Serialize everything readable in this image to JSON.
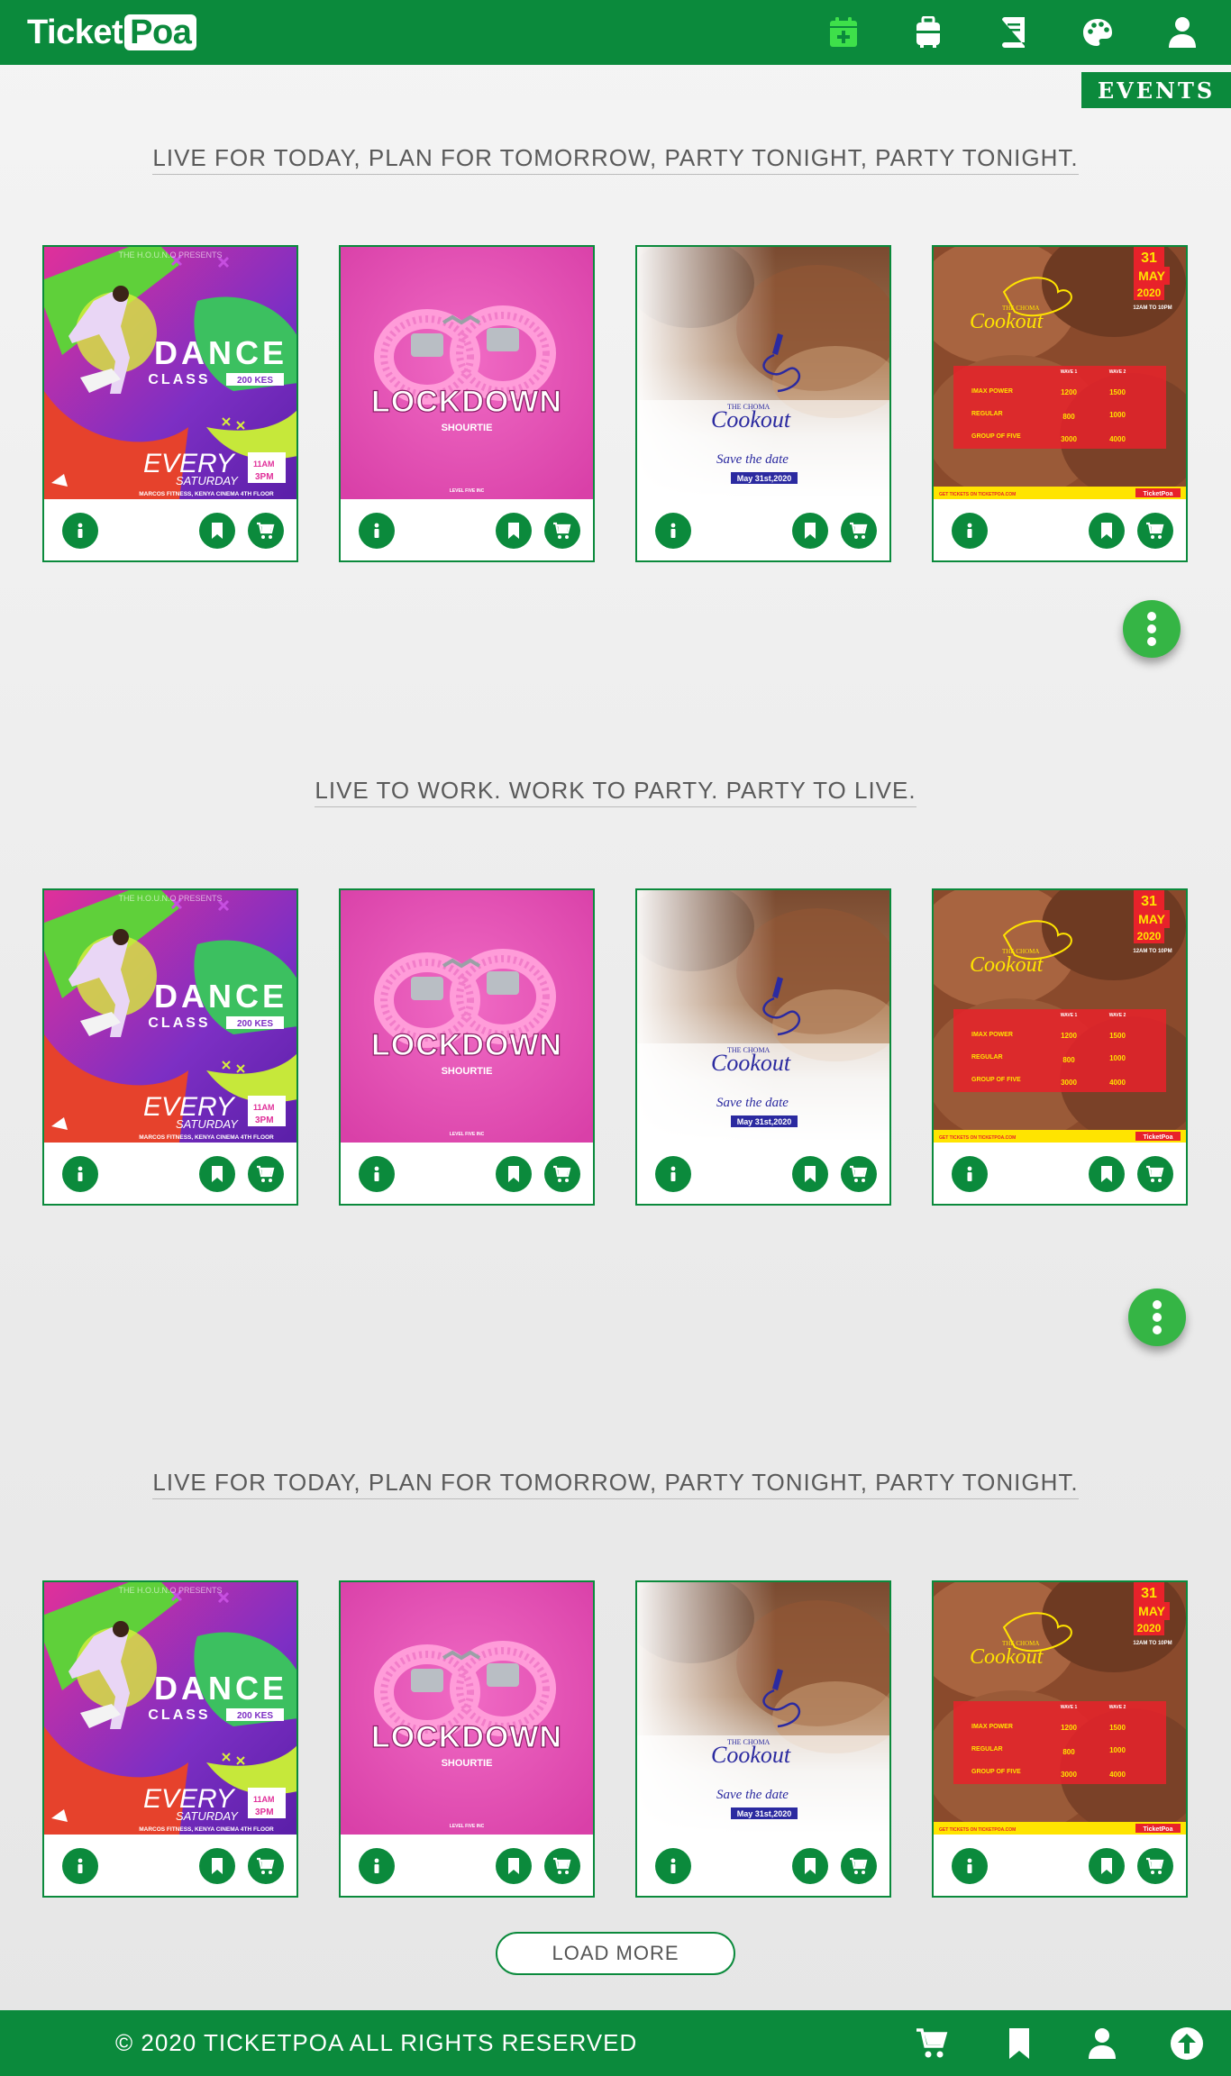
{
  "header": {
    "logo_ticket": "Ticket",
    "logo_poa": "Poa",
    "icons": [
      "add-event-icon",
      "luggage-icon",
      "book-icon",
      "palette-icon",
      "user-icon"
    ]
  },
  "events_tab": "EVENTS",
  "sections": [
    {
      "heading": "LIVE FOR TODAY, PLAN FOR TOMORROW, PARTY TONIGHT, PARTY TONIGHT."
    },
    {
      "heading": "LIVE TO WORK. WORK TO PARTY. PARTY TO LIVE."
    },
    {
      "heading": "LIVE FOR TODAY, PLAN FOR TOMORROW, PARTY TONIGHT, PARTY TONIGHT."
    }
  ],
  "posters": {
    "dance": {
      "presents": "THE H.O.U.N.O PRESENTS",
      "title1": "DANCE",
      "title2": "CLASS",
      "price": "200 KES",
      "every": "EVERY",
      "day": "SATURDAY",
      "time_from": "11AM",
      "time_to": "3PM",
      "venue": "MARCOS FITNESS, KENYA CINEMA 4TH FLOOR"
    },
    "lockdown": {
      "title": "LOCKDOWN",
      "artist": "SHOURTIE",
      "label": "LEVEL FIVE INC"
    },
    "choma": {
      "brand": "THE CHOMA",
      "name": "Cookout",
      "tag": "Save the date",
      "date": "May 31st,2020"
    },
    "cookout": {
      "day": "31",
      "month": "MAY",
      "year": "2020",
      "time": "12AM TO 10PM",
      "brand": "THE CHOMA",
      "name": "Cookout",
      "col1": "WAVE 1",
      "col2": "WAVE 2",
      "rows": [
        {
          "name": "IMAX POWER",
          "a": "1200",
          "b": "1500"
        },
        {
          "name": "REGULAR",
          "a": "800",
          "b": "1000"
        },
        {
          "name": "GROUP OF FIVE",
          "a": "3000",
          "b": "4000"
        }
      ],
      "footer_left": "GET TICKETS ON TICKETPOA.COM",
      "footer_right": "TicketPoa"
    }
  },
  "card_actions": {
    "info": "info-icon",
    "bookmark": "bookmark-icon",
    "cart": "cart-icon"
  },
  "load_more": "LOAD MORE",
  "footer": {
    "copyright": "© 2020 TICKETPOA ALL RIGHTS RESERVED",
    "icons": [
      "cart-icon",
      "bookmark-icon",
      "user-icon",
      "arrow-up-icon"
    ]
  }
}
